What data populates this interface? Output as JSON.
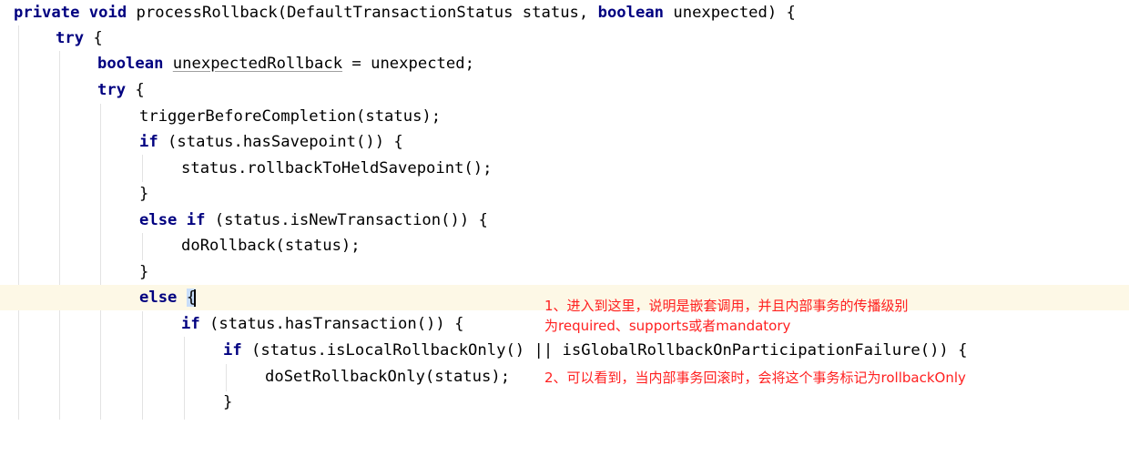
{
  "code": {
    "l1": {
      "kw1": "private",
      "kw2": "void",
      "t1": " processRollback(DefaultTransactionStatus status, ",
      "kw3": "boolean",
      "t2": " unexpected) {"
    },
    "l2": {
      "kw": "try",
      "t": " {"
    },
    "l3": {
      "kw": "boolean",
      "var": "unexpectedRollback",
      "t": " = unexpected;"
    },
    "l4": {
      "kw": "try",
      "t": " {"
    },
    "l5": {
      "t": "triggerBeforeCompletion(status);"
    },
    "l6": {
      "kw": "if",
      "t": " (status.hasSavepoint()) {"
    },
    "l7": {
      "t": "status.rollbackToHeldSavepoint();"
    },
    "l8": {
      "t": "}"
    },
    "l9": {
      "kw": "else if",
      "t": " (status.isNewTransaction()) {"
    },
    "l10": {
      "t": "doRollback(status);"
    },
    "l11": {
      "t": "}"
    },
    "l12": {
      "kw": "else",
      "brace": "{"
    },
    "l13": {
      "kw": "if",
      "t": " (status.hasTransaction()) {"
    },
    "l14": {
      "kw": "if",
      "t": " (status.isLocalRollbackOnly() || isGlobalRollbackOnParticipationFailure()) {"
    },
    "l15": {
      "t": "doSetRollbackOnly(status);"
    },
    "l16": {
      "t": "}"
    }
  },
  "annotations": {
    "note1_line1": "1、进入到这里，说明是嵌套调用，并且内部事务的传播级别",
    "note1_line2": "为required、supports或者mandatory",
    "note2": "2、可以看到，当内部事务回滚时，会将这个事务标记为rollbackOnly"
  },
  "colors": {
    "keyword": "#000080",
    "annotation": "#ff2020",
    "current_line": "#fdf8e6",
    "brace_highlight": "#c9defa"
  }
}
